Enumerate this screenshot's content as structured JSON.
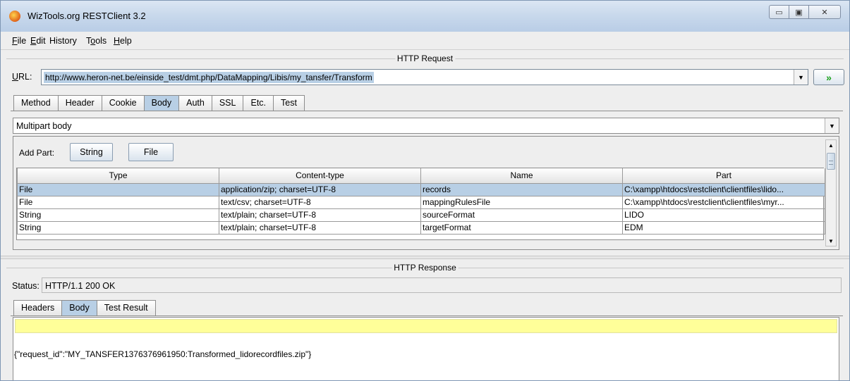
{
  "window": {
    "title": "WizTools.org RESTClient 3.2",
    "icon": "restclient-app-icon",
    "controls": {
      "minimize": "▭",
      "maximize": "▣",
      "close": "✕"
    }
  },
  "menu": {
    "items": [
      {
        "label": "File",
        "mnemonic": "F"
      },
      {
        "label": "Edit",
        "mnemonic": "E"
      },
      {
        "label": "History",
        "mnemonic": ""
      },
      {
        "label": "Tools",
        "mnemonic": "o"
      },
      {
        "label": "Help",
        "mnemonic": "H"
      }
    ]
  },
  "request": {
    "section_title": "HTTP Request",
    "url_label": "URL:",
    "url_value": "http://www.heron-net.be/einside_test/dmt.php/DataMapping/Libis/my_tansfer/Transform",
    "go_button": "»",
    "tabs": [
      "Method",
      "Header",
      "Cookie",
      "Body",
      "Auth",
      "SSL",
      "Etc.",
      "Test"
    ],
    "active_tab": "Body",
    "body_type": "Multipart body",
    "add_part_label": "Add Part:",
    "add_string_button": "String",
    "add_file_button": "File",
    "parts_table": {
      "columns": [
        "Type",
        "Content-type",
        "Name",
        "Part"
      ],
      "rows": [
        [
          "File",
          "application/zip; charset=UTF-8",
          "records",
          "C:\\xampp\\htdocs\\restclient\\clientfiles\\lido..."
        ],
        [
          "File",
          "text/csv; charset=UTF-8",
          "mappingRulesFile",
          "C:\\xampp\\htdocs\\restclient\\clientfiles\\myr..."
        ],
        [
          "String",
          "text/plain; charset=UTF-8",
          "sourceFormat",
          "LIDO"
        ],
        [
          "String",
          "text/plain; charset=UTF-8",
          "targetFormat",
          "EDM"
        ]
      ],
      "selected_row": 0
    }
  },
  "response": {
    "section_title": "HTTP Response",
    "status_label": "Status:",
    "status_value": "HTTP/1.1 200 OK",
    "tabs": [
      "Headers",
      "Body",
      "Test Result"
    ],
    "active_tab": "Body",
    "body_text": "{\"request_id\":\"MY_TANSFER1376376961950:Transformed_lidorecordfiles.zip\"}"
  },
  "colors": {
    "selection": "#b8cfe5",
    "go_arrow": "#1aa01a",
    "response_highlight": "#ffff99"
  }
}
